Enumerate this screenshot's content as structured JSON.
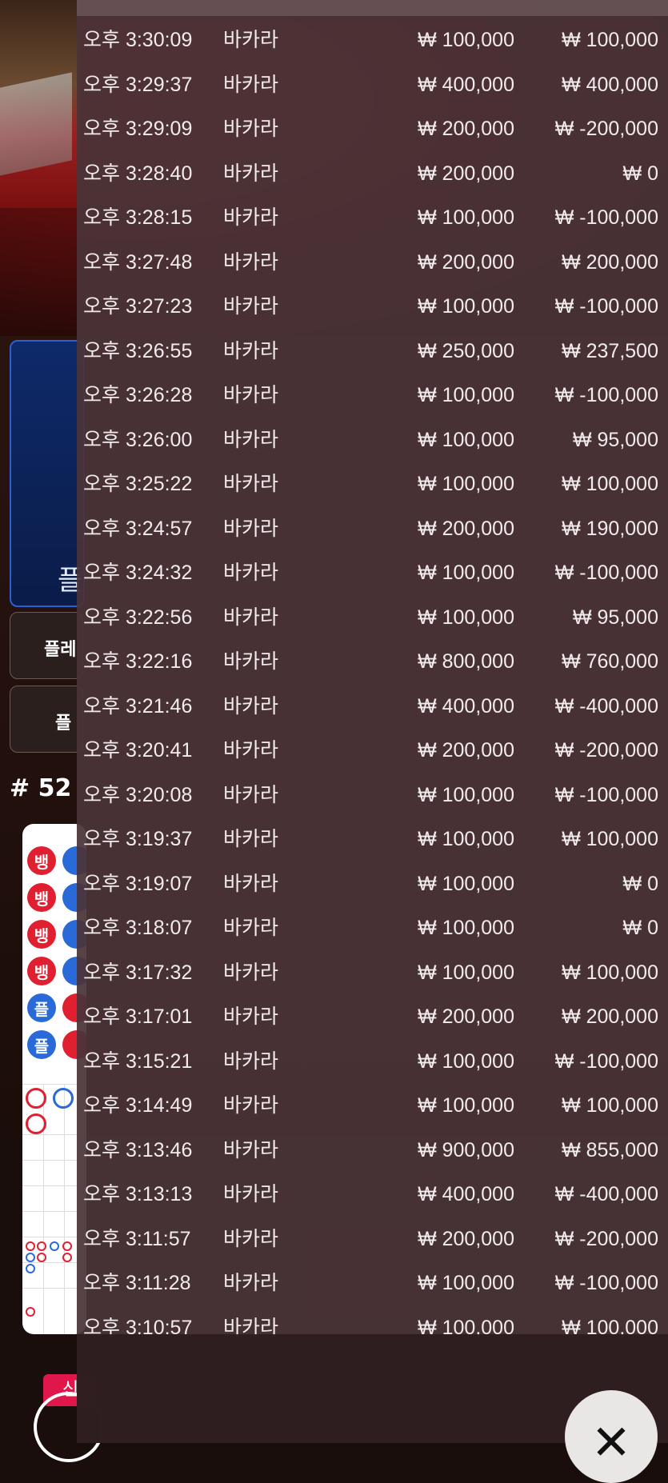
{
  "background": {
    "player_panel_label": "플",
    "side_buttons": [
      "플레",
      "플"
    ],
    "round_number": "# 52",
    "bead_road": [
      "뱅",
      "뱅",
      "뱅",
      "뱅",
      "플",
      "플"
    ],
    "new_badge": "신"
  },
  "history": {
    "rows": [
      {
        "time": "오후 3:30:09",
        "game": "바카라",
        "bet": "₩ 100,000",
        "payout": "₩ 100,000"
      },
      {
        "time": "오후 3:29:37",
        "game": "바카라",
        "bet": "₩ 400,000",
        "payout": "₩ 400,000"
      },
      {
        "time": "오후 3:29:09",
        "game": "바카라",
        "bet": "₩ 200,000",
        "payout": "₩ -200,000"
      },
      {
        "time": "오후 3:28:40",
        "game": "바카라",
        "bet": "₩ 200,000",
        "payout": "₩ 0"
      },
      {
        "time": "오후 3:28:15",
        "game": "바카라",
        "bet": "₩ 100,000",
        "payout": "₩ -100,000"
      },
      {
        "time": "오후 3:27:48",
        "game": "바카라",
        "bet": "₩ 200,000",
        "payout": "₩ 200,000"
      },
      {
        "time": "오후 3:27:23",
        "game": "바카라",
        "bet": "₩ 100,000",
        "payout": "₩ -100,000"
      },
      {
        "time": "오후 3:26:55",
        "game": "바카라",
        "bet": "₩ 250,000",
        "payout": "₩ 237,500"
      },
      {
        "time": "오후 3:26:28",
        "game": "바카라",
        "bet": "₩ 100,000",
        "payout": "₩ -100,000"
      },
      {
        "time": "오후 3:26:00",
        "game": "바카라",
        "bet": "₩ 100,000",
        "payout": "₩ 95,000"
      },
      {
        "time": "오후 3:25:22",
        "game": "바카라",
        "bet": "₩ 100,000",
        "payout": "₩ 100,000"
      },
      {
        "time": "오후 3:24:57",
        "game": "바카라",
        "bet": "₩ 200,000",
        "payout": "₩ 190,000"
      },
      {
        "time": "오후 3:24:32",
        "game": "바카라",
        "bet": "₩ 100,000",
        "payout": "₩ -100,000"
      },
      {
        "time": "오후 3:22:56",
        "game": "바카라",
        "bet": "₩ 100,000",
        "payout": "₩ 95,000"
      },
      {
        "time": "오후 3:22:16",
        "game": "바카라",
        "bet": "₩ 800,000",
        "payout": "₩ 760,000"
      },
      {
        "time": "오후 3:21:46",
        "game": "바카라",
        "bet": "₩ 400,000",
        "payout": "₩ -400,000"
      },
      {
        "time": "오후 3:20:41",
        "game": "바카라",
        "bet": "₩ 200,000",
        "payout": "₩ -200,000"
      },
      {
        "time": "오후 3:20:08",
        "game": "바카라",
        "bet": "₩ 100,000",
        "payout": "₩ -100,000"
      },
      {
        "time": "오후 3:19:37",
        "game": "바카라",
        "bet": "₩ 100,000",
        "payout": "₩ 100,000"
      },
      {
        "time": "오후 3:19:07",
        "game": "바카라",
        "bet": "₩ 100,000",
        "payout": "₩ 0"
      },
      {
        "time": "오후 3:18:07",
        "game": "바카라",
        "bet": "₩ 100,000",
        "payout": "₩ 0"
      },
      {
        "time": "오후 3:17:32",
        "game": "바카라",
        "bet": "₩ 100,000",
        "payout": "₩ 100,000"
      },
      {
        "time": "오후 3:17:01",
        "game": "바카라",
        "bet": "₩ 200,000",
        "payout": "₩ 200,000"
      },
      {
        "time": "오후 3:15:21",
        "game": "바카라",
        "bet": "₩ 100,000",
        "payout": "₩ -100,000"
      },
      {
        "time": "오후 3:14:49",
        "game": "바카라",
        "bet": "₩ 100,000",
        "payout": "₩ 100,000"
      },
      {
        "time": "오후 3:13:46",
        "game": "바카라",
        "bet": "₩ 900,000",
        "payout": "₩ 855,000"
      },
      {
        "time": "오후 3:13:13",
        "game": "바카라",
        "bet": "₩ 400,000",
        "payout": "₩ -400,000"
      },
      {
        "time": "오후 3:11:57",
        "game": "바카라",
        "bet": "₩ 200,000",
        "payout": "₩ -200,000"
      },
      {
        "time": "오후 3:11:28",
        "game": "바카라",
        "bet": "₩ 100,000",
        "payout": "₩ -100,000"
      },
      {
        "time": "오후 3:10:57",
        "game": "바카라",
        "bet": "₩ 100,000",
        "payout": "₩ 100,000"
      }
    ]
  },
  "close_button": {
    "icon": "close-icon",
    "symbol": "✕"
  },
  "colors": {
    "overlay": "#4a3438",
    "banker": "#e02030",
    "player": "#2a6ad8"
  }
}
